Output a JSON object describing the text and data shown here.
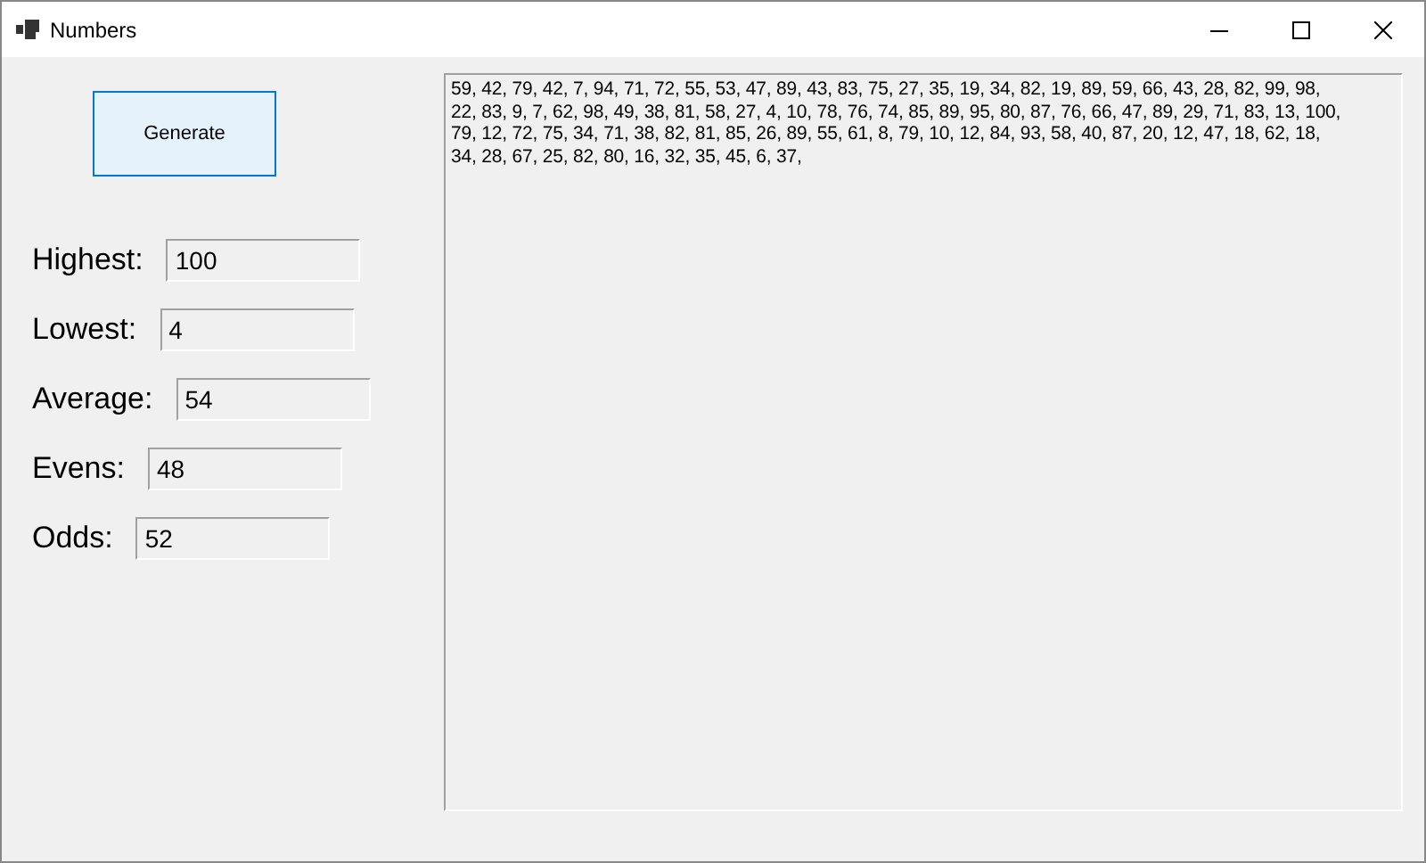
{
  "window": {
    "title": "Numbers"
  },
  "generate_button": {
    "label": "Generate"
  },
  "stats": [
    {
      "label": "Highest:",
      "value": "100"
    },
    {
      "label": "Lowest:",
      "value": "4"
    },
    {
      "label": "Average:",
      "value": "54"
    },
    {
      "label": "Evens:",
      "value": "48"
    },
    {
      "label": "Odds:",
      "value": "52"
    }
  ],
  "output": {
    "lines": [
      "59, 42, 79, 42, 7, 94, 71, 72, 55, 53, 47, 89, 43, 83, 75, 27, 35, 19, 34, 82, 19, 89, 59, 66, 43, 28, 82, 99, 98,",
      "22, 83, 9, 7, 62, 98, 49, 38, 81, 58, 27, 4, 10, 78, 76, 74, 85, 89, 95, 80, 87, 76, 66, 47, 89, 29, 71, 83, 13, 100,",
      "79, 12, 72, 75, 34, 71, 38, 82, 81, 85, 26, 89, 55, 61, 8, 79, 10, 12, 84, 93, 58, 40, 87, 20, 12, 47, 18, 62, 18,",
      "34, 28, 67, 25, 82, 80, 16, 32, 35, 45, 6, 37,"
    ]
  }
}
